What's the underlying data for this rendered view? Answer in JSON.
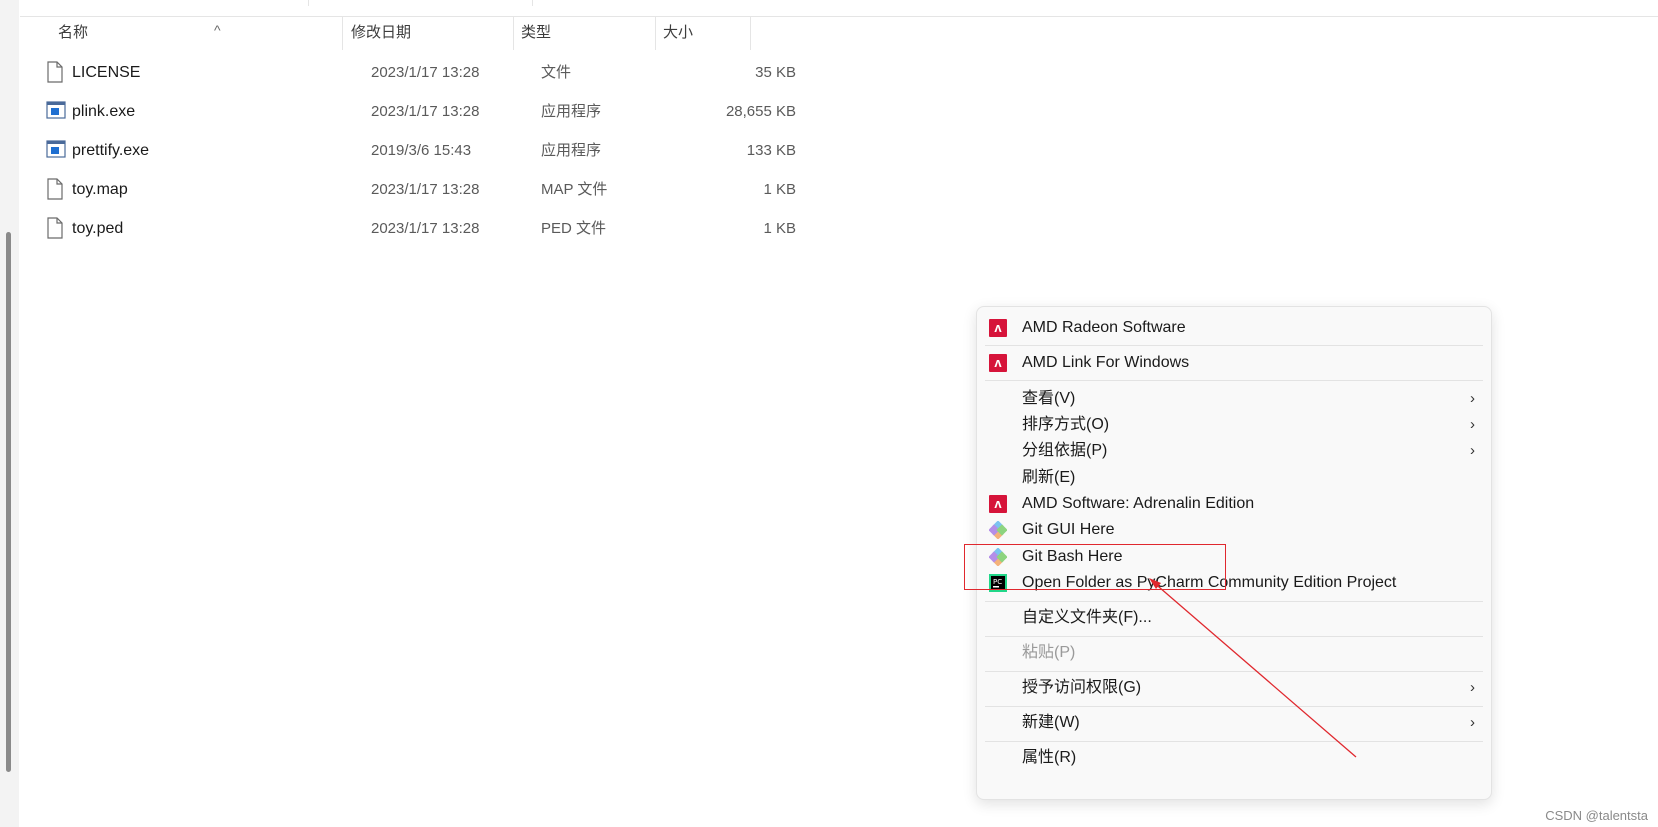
{
  "columns": {
    "name": "名称",
    "date": "修改日期",
    "type": "类型",
    "size": "大小"
  },
  "files": [
    {
      "name": "LICENSE",
      "date": "2023/1/17 13:28",
      "type": "文件",
      "size": "35 KB",
      "icon": "file-icon"
    },
    {
      "name": "plink.exe",
      "date": "2023/1/17 13:28",
      "type": "应用程序",
      "size": "28,655 KB",
      "icon": "exe-icon"
    },
    {
      "name": "prettify.exe",
      "date": "2019/3/6 15:43",
      "type": "应用程序",
      "size": "133 KB",
      "icon": "exe-icon"
    },
    {
      "name": "toy.map",
      "date": "2023/1/17 13:28",
      "type": "MAP 文件",
      "size": "1 KB",
      "icon": "file-icon"
    },
    {
      "name": "toy.ped",
      "date": "2023/1/17 13:28",
      "type": "PED 文件",
      "size": "1 KB",
      "icon": "file-icon"
    }
  ],
  "context_menu": {
    "amd_radeon": "AMD Radeon Software",
    "amd_link": "AMD Link For Windows",
    "view": "查看(V)",
    "sort": "排序方式(O)",
    "group": "分组依据(P)",
    "refresh": "刷新(E)",
    "amd_adrenalin": "AMD Software: Adrenalin Edition",
    "git_gui": "Git GUI Here",
    "git_bash": "Git Bash Here",
    "pycharm": "Open Folder as PyCharm Community Edition Project",
    "customize": "自定义文件夹(F)...",
    "paste": "粘贴(P)",
    "grant_access": "授予访问权限(G)",
    "new": "新建(W)",
    "properties": "属性(R)"
  },
  "annotation_color": "#e0282e",
  "amd_color": "#d6143a",
  "watermark": "CSDN @talentsta"
}
